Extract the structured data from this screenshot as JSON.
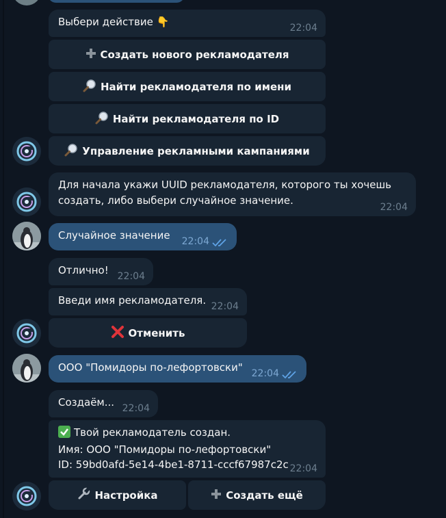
{
  "messages": {
    "choose": {
      "text": "Выбери действие 👇",
      "time": "22:04"
    },
    "uuid_prompt": {
      "line1": "Для начала укажи UUID рекламодателя, которого ты хочешь",
      "line2": "создать, либо выбери случайное значение.",
      "time": "22:04"
    },
    "random": {
      "text": "Случайное значение",
      "time": "22:04"
    },
    "great": {
      "text": "Отлично!",
      "time": "22:04"
    },
    "enter_name": {
      "text": "Введи имя рекламодателя.",
      "time": "22:04"
    },
    "company": {
      "text": "ООО \"Помидоры по-лефортовски\"",
      "time": "22:04"
    },
    "creating": {
      "text": "Создаём...",
      "time": "22:04"
    },
    "created": {
      "line1": "Твой рекламодатель создан.",
      "line2": "Имя: ООО \"Помидоры по-лефортовски\"",
      "line3": "ID: 59bd0afd-5e14-4be1-8711-cccf67987c2c",
      "time": "22:04"
    }
  },
  "buttons": {
    "create": {
      "icon": "plus-icon",
      "label": "Создать нового рекламодателя"
    },
    "find_name": {
      "icon": "magnifier-icon",
      "label": "Найти рекламодателя по имени"
    },
    "find_id": {
      "icon": "magnifier-icon",
      "label": "Найти рекламодателя по ID"
    },
    "campaigns": {
      "icon": "magnifier-icon",
      "label": "Управление рекламными кампаниями"
    },
    "cancel": {
      "icon": "cross-mark-icon",
      "label": "Отменить"
    },
    "settings": {
      "icon": "wrench-icon",
      "label": "Настройка"
    },
    "create_more": {
      "icon": "plus-icon",
      "label": "Создать ещё"
    }
  },
  "colors": {
    "background": "#0e1621",
    "incoming_bubble": "#182533",
    "outgoing_bubble": "#2b5278",
    "time_text": "#6d7f8f",
    "read_check": "#5fa3e6"
  }
}
